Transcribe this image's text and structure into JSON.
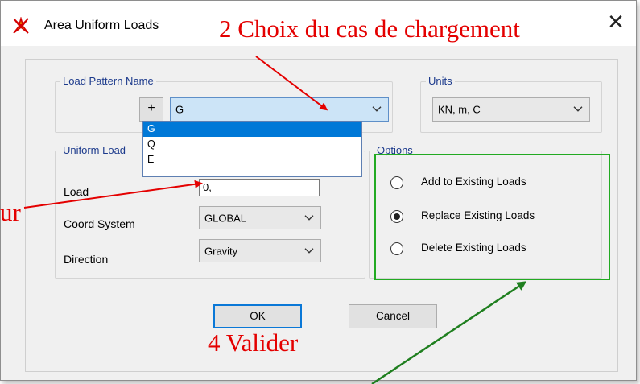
{
  "window": {
    "title": "Area Uniform Loads",
    "close_glyph": "✕"
  },
  "load_pattern": {
    "legend": "Load Pattern Name",
    "add_label": "+",
    "selected": "G",
    "options": [
      "G",
      "Q",
      "E"
    ]
  },
  "units": {
    "legend": "Units",
    "selected": "KN, m, C"
  },
  "uniform_load": {
    "legend": "Uniform Load",
    "load_label": "Load",
    "load_value": "0,",
    "coord_label": "Coord System",
    "coord_value": "GLOBAL",
    "direction_label": "Direction",
    "direction_value": "Gravity"
  },
  "options": {
    "legend": "Options",
    "items": [
      {
        "label": "Add to Existing Loads",
        "checked": false
      },
      {
        "label": "Replace Existing Loads",
        "checked": true
      },
      {
        "label": "Delete Existing Loads",
        "checked": false
      }
    ]
  },
  "buttons": {
    "ok": "OK",
    "cancel": "Cancel"
  },
  "annotations": {
    "choice_case": "2 Choix du cas de chargement",
    "value_fragment": "ur",
    "validate": "4 Valider"
  },
  "colors": {
    "accent": "#0078d7",
    "annotation_red": "#e40000",
    "highlight_green": "#22aa22",
    "arrow_green": "#1f7f1f",
    "legend_blue": "#1c3a8c"
  },
  "icons": {
    "app": "sap2000-app-icon",
    "close": "close-icon",
    "chevron": "chevron-down-icon"
  }
}
